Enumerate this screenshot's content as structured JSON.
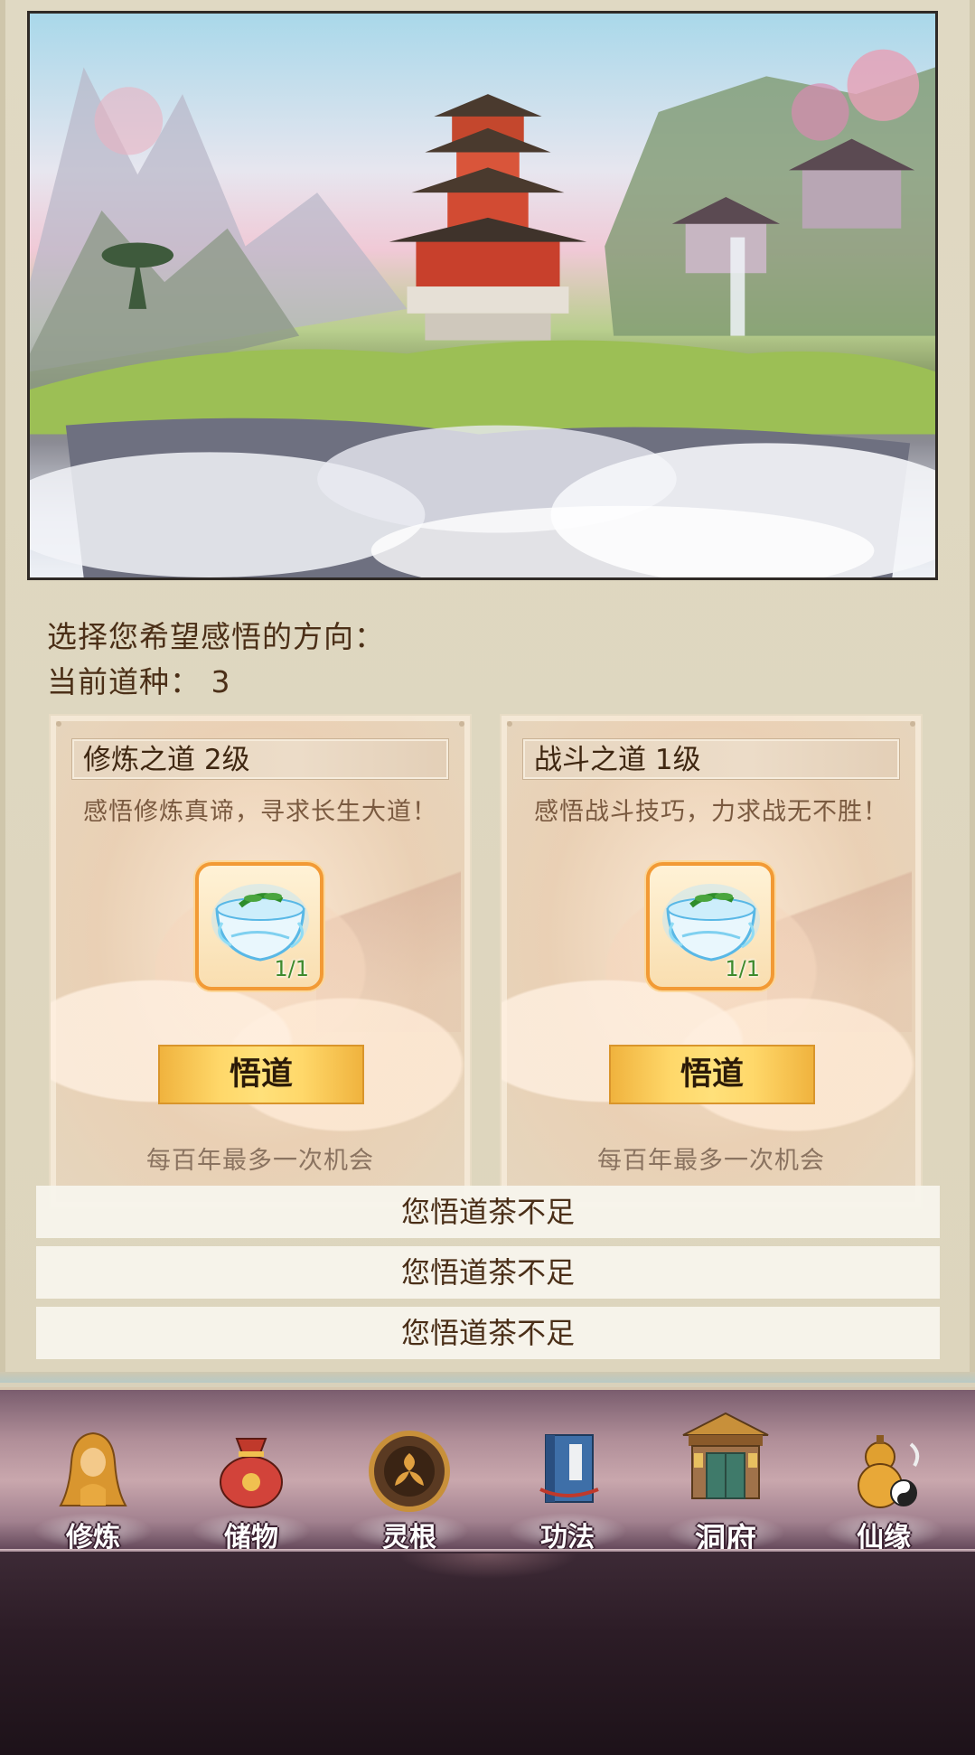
{
  "prompt": {
    "direction_label": "选择您希望感悟的方向：",
    "seed_label": "当前道种：",
    "seed_value": "3"
  },
  "cards": [
    {
      "title": "修炼之道 2级",
      "description": "感悟修炼真谛，寻求长生大道！",
      "item_icon": "tea-cup-icon",
      "item_count": "1/1",
      "button_label": "悟道",
      "note": "每百年最多一次机会"
    },
    {
      "title": "战斗之道 1级",
      "description": "感悟战斗技巧，力求战无不胜！",
      "item_icon": "tea-cup-icon",
      "item_count": "1/1",
      "button_label": "悟道",
      "note": "每百年最多一次机会"
    }
  ],
  "toasts": [
    "您悟道茶不足",
    "您悟道茶不足",
    "您悟道茶不足"
  ],
  "nav": [
    {
      "label": "修炼",
      "icon": "meditating-monk-icon"
    },
    {
      "label": "储物",
      "icon": "treasure-bag-icon"
    },
    {
      "label": "灵根",
      "icon": "spirit-root-emblem-icon"
    },
    {
      "label": "功法",
      "icon": "scripture-book-icon"
    },
    {
      "label": "洞府",
      "icon": "cave-abode-gate-icon"
    },
    {
      "label": "仙缘",
      "icon": "gourd-yinyang-icon"
    }
  ],
  "colors": {
    "text_brown": "#4b2f17",
    "button_gold": "#ffd86a",
    "slot_orange": "#f29a35",
    "count_green": "#3e8a2c"
  }
}
